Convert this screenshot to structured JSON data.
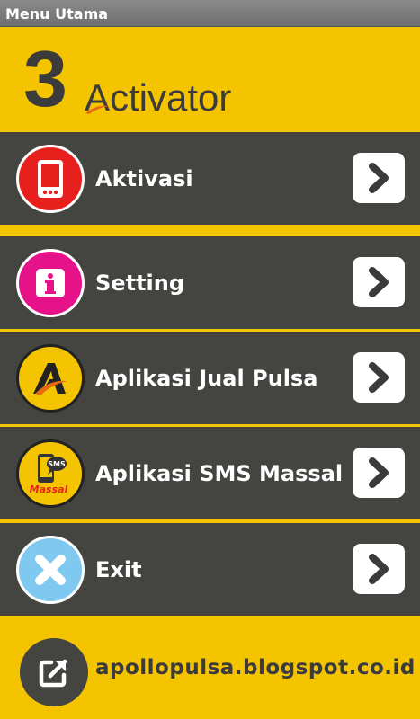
{
  "window": {
    "title": "Menu Utama"
  },
  "header": {
    "logo_number": "3",
    "logo_text": "Activator"
  },
  "menu": {
    "items": [
      {
        "label": "Aktivasi",
        "icon": "phone-icon",
        "color": "#e8201d"
      },
      {
        "label": "Setting",
        "icon": "info-icon",
        "color": "#e6128a"
      },
      {
        "label": "Aplikasi Jual Pulsa",
        "icon": "apollo-a-icon",
        "color": "#f5c400"
      },
      {
        "label": "Aplikasi SMS Massal",
        "icon": "sms-massal-icon",
        "color": "#f5c400",
        "badge_top": "SMS",
        "badge_bottom": "Massal"
      },
      {
        "label": "Exit",
        "icon": "close-icon",
        "color": "#7fc8f0"
      }
    ]
  },
  "footer": {
    "link_text": "apollopulsa.blogspot.co.id",
    "icon": "external-link-icon"
  },
  "colors": {
    "background": "#f5c400",
    "menu_bg": "#444441",
    "text_dark": "#3b3b3b"
  }
}
